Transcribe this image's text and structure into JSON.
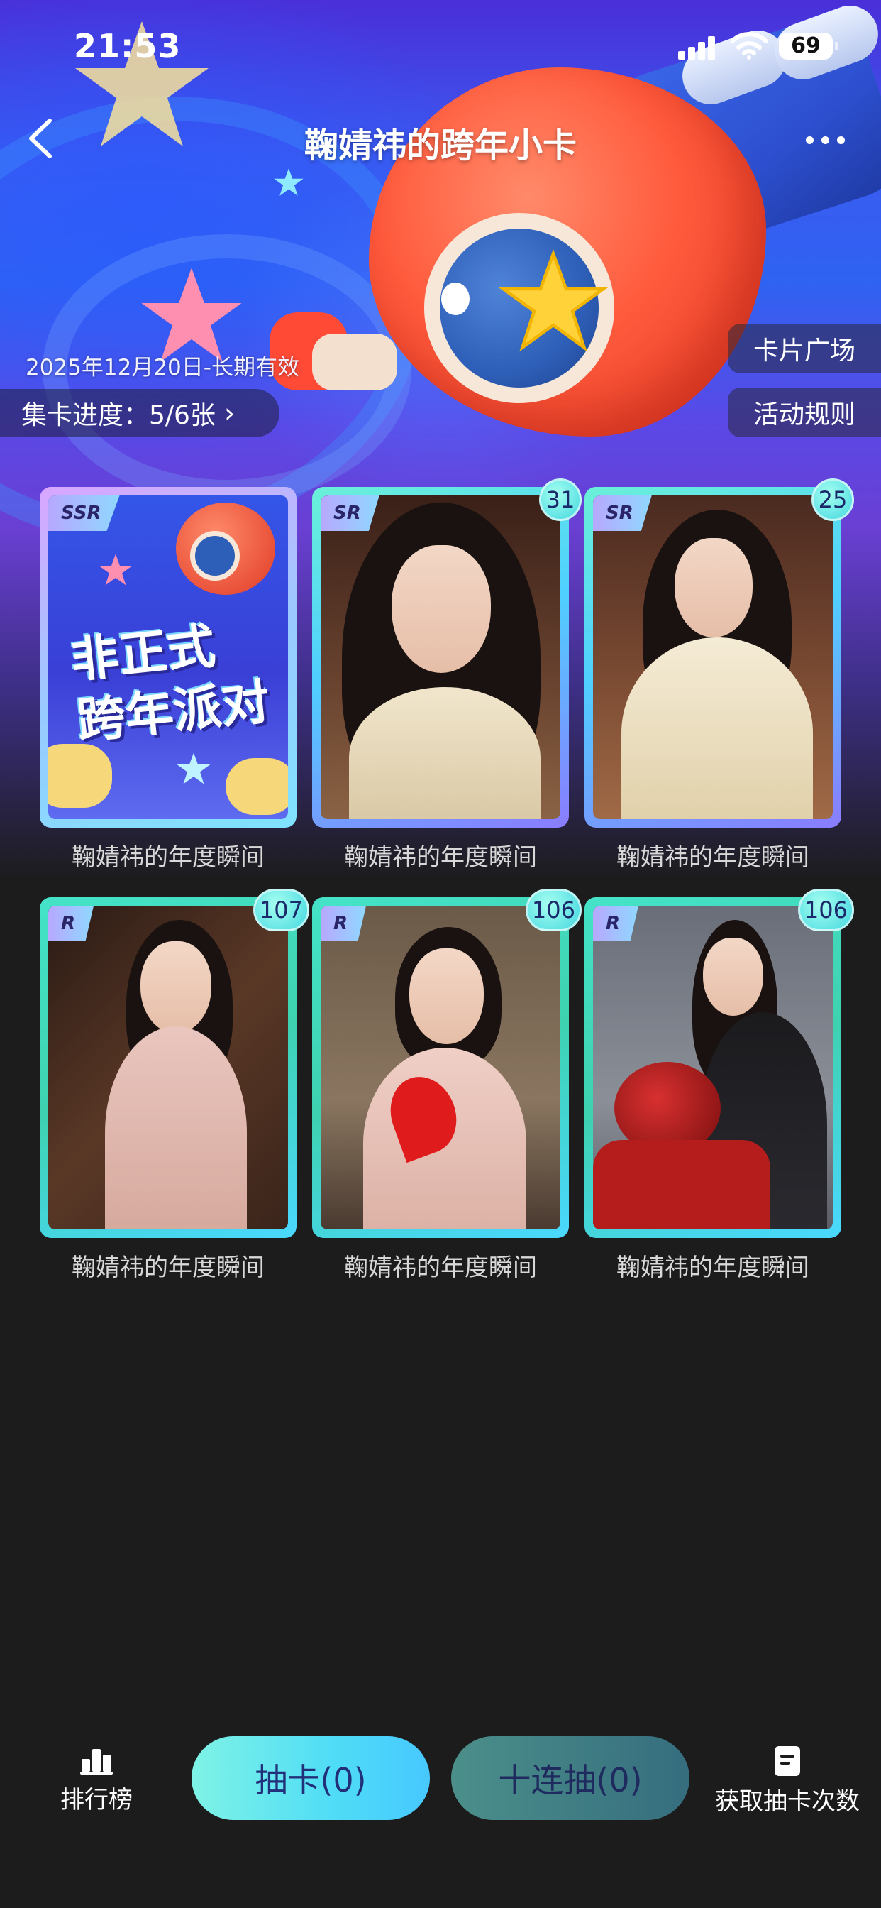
{
  "status_bar": {
    "time": "21:53",
    "battery": "69"
  },
  "nav": {
    "title": "鞠婧祎的跨年小卡"
  },
  "event": {
    "validity": "2025年12月20日-长期有效",
    "progress_label": "集卡进度：5/6张",
    "side_buttons": [
      "卡片广场",
      "活动规则"
    ]
  },
  "cards": [
    {
      "rarity": "SSR",
      "count": "",
      "label": "鞠婧祎的年度瞬间",
      "art_text": [
        "非正式",
        "跨年派对"
      ]
    },
    {
      "rarity": "SR",
      "count": "31",
      "label": "鞠婧祎的年度瞬间"
    },
    {
      "rarity": "SR",
      "count": "25",
      "label": "鞠婧祎的年度瞬间"
    },
    {
      "rarity": "R",
      "count": "107",
      "label": "鞠婧祎的年度瞬间"
    },
    {
      "rarity": "R",
      "count": "106",
      "label": "鞠婧祎的年度瞬间"
    },
    {
      "rarity": "R",
      "count": "106",
      "label": "鞠婧祎的年度瞬间"
    }
  ],
  "bottom_bar": {
    "ranking_label": "排行榜",
    "draw_one_label": "抽卡(0)",
    "draw_ten_label": "十连抽(0)",
    "get_draws_label": "获取抽卡次数"
  },
  "icons": {
    "back": "chevron-left-icon",
    "more": "more-icon",
    "ranking": "ranking-icon",
    "get_draws": "document-icon"
  },
  "colors": {
    "page_bg": "#1c1c1c",
    "accent_teal": "#4fdcf6",
    "button_text": "#22307a"
  }
}
